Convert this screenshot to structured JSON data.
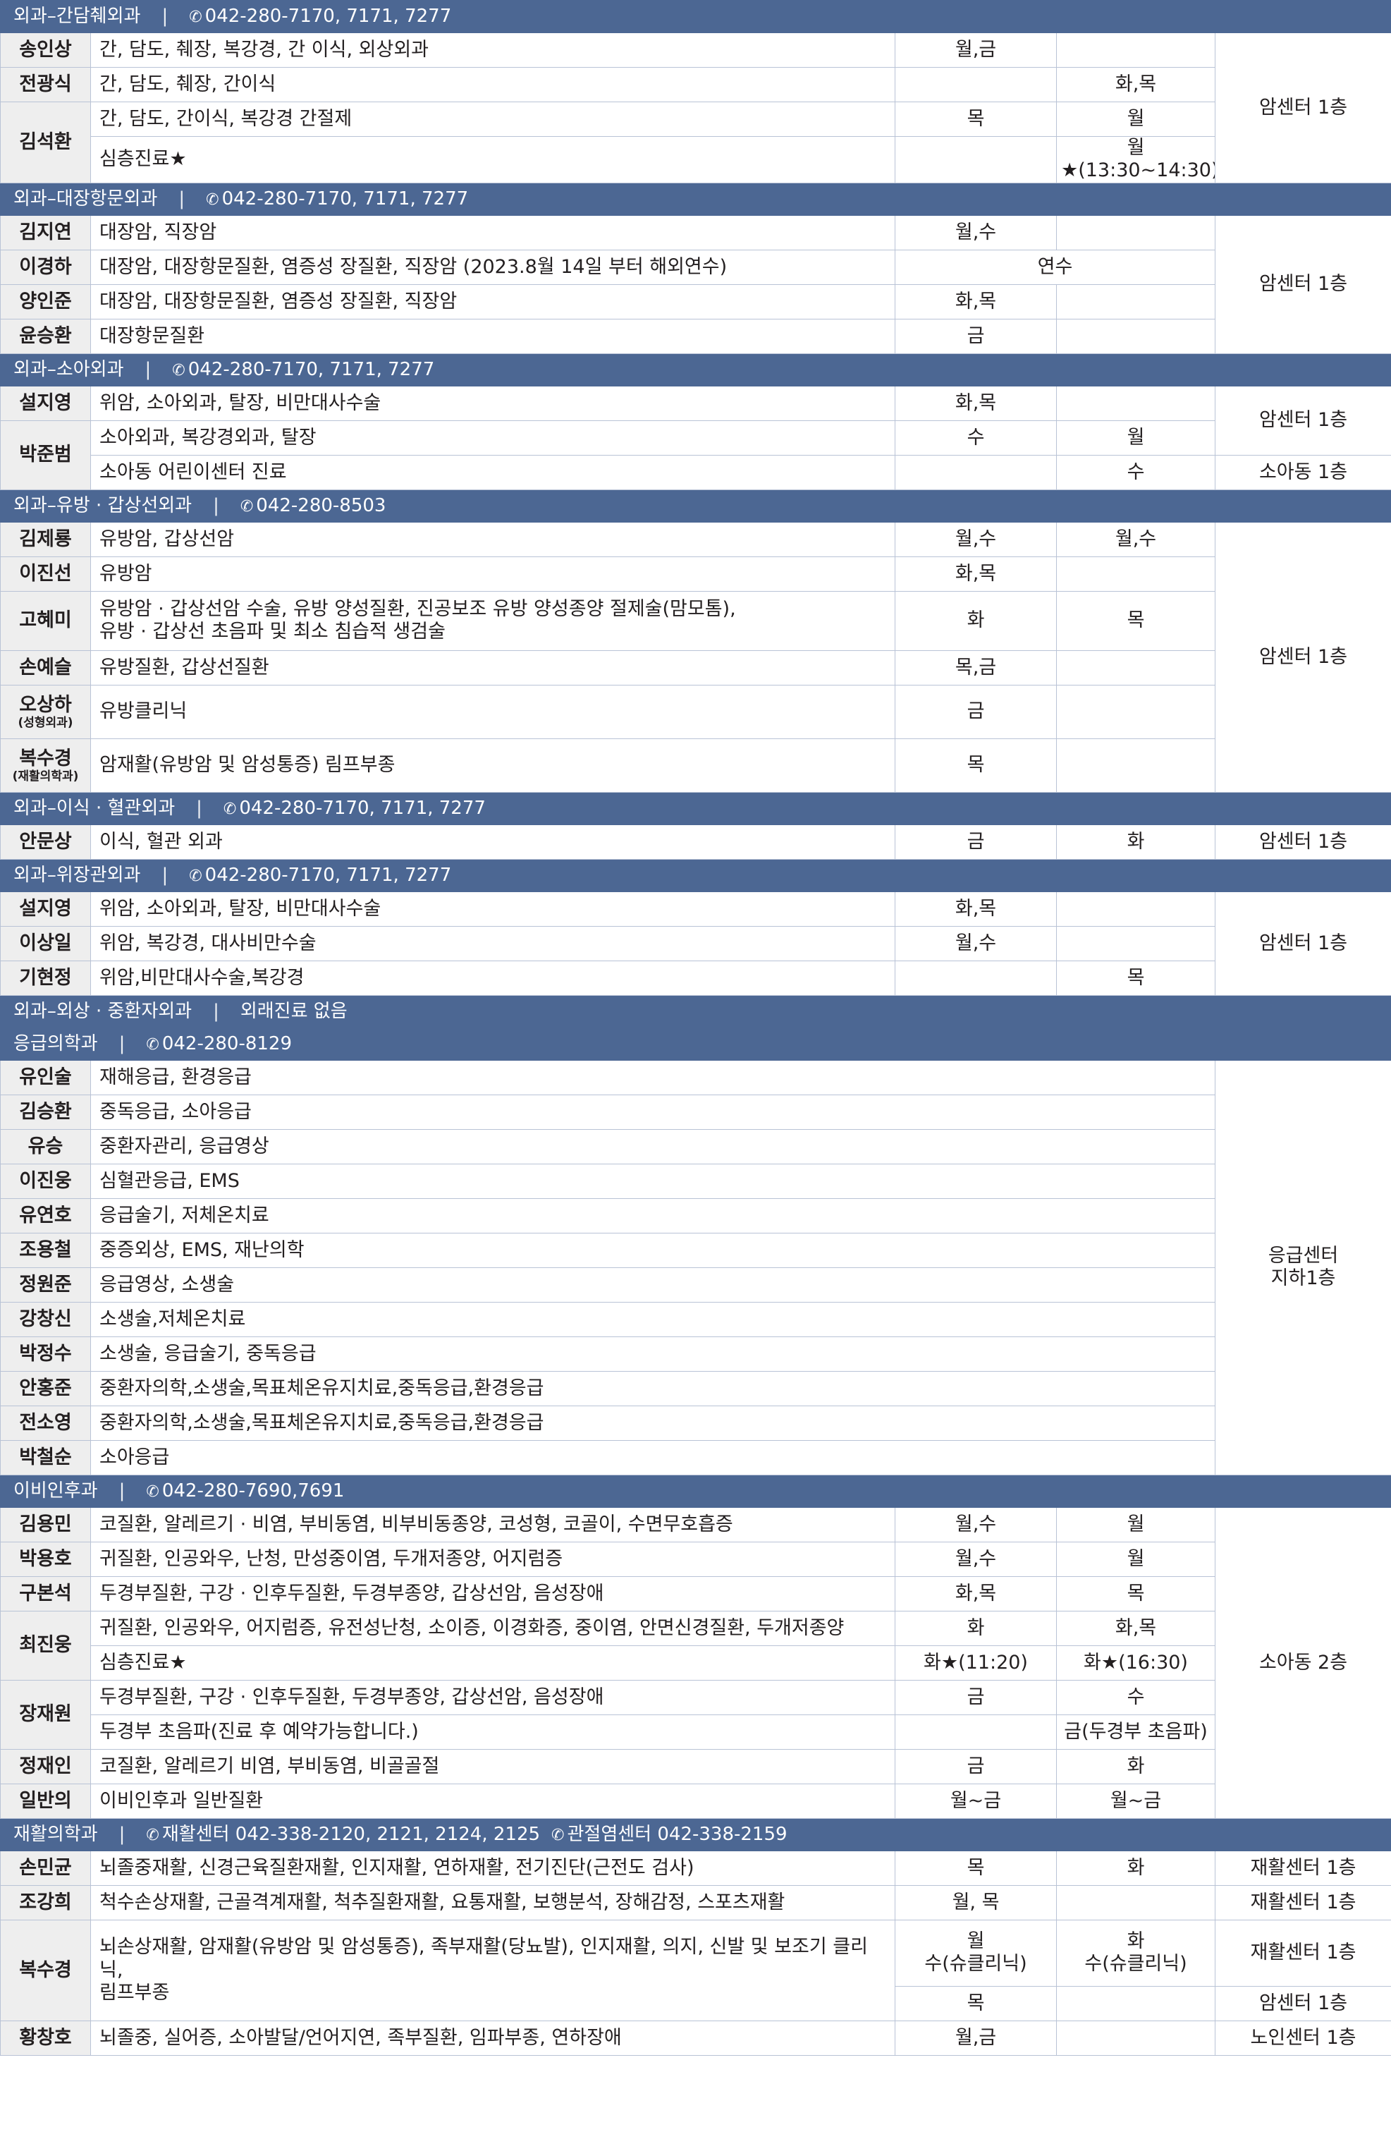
{
  "sections": {
    "s1": {
      "title": "외과–간담췌외과",
      "phone": "042-280-7170, 7171, 7277"
    },
    "s2": {
      "title": "외과–대장항문외과",
      "phone": "042-280-7170, 7171, 7277"
    },
    "s3": {
      "title": "외과–소아외과",
      "phone": "042-280-7170, 7171, 7277"
    },
    "s4": {
      "title": "외과–유방 · 갑상선외과",
      "phone": "042-280-8503"
    },
    "s5": {
      "title": "외과–이식 · 혈관외과",
      "phone": "042-280-7170, 7171, 7277"
    },
    "s6": {
      "title": "외과–위장관외과",
      "phone": "042-280-7170, 7171, 7277"
    },
    "s7": {
      "title": "외과–외상 · 중환자외과",
      "note": "외래진료 없음"
    },
    "s8": {
      "title": "응급의학과",
      "phone": "042-280-8129"
    },
    "s9": {
      "title": "이비인후과",
      "phone": "042-280-7690,7691"
    },
    "s10": {
      "title": "재활의학과",
      "phone1": "재활센터 042-338-2120, 2121, 2124, 2125",
      "phone2": "관절염센터 042-338-2159"
    }
  },
  "rows": {
    "s1": [
      {
        "name": "송인상",
        "area": "간, 담도, 췌장, 복강경, 간 이식, 외상외과",
        "am": "월,금",
        "pm": "",
        "loc": "암센터 1층"
      },
      {
        "name": "전광식",
        "area": "간, 담도, 췌장, 간이식",
        "am": "",
        "pm": "화,목"
      },
      {
        "name": "김석환",
        "area": "간, 담도, 간이식, 복강경 간절제",
        "am": "목",
        "pm": "월"
      },
      {
        "area": "심층진료★",
        "am": "",
        "pm": "월★(13:30~14:30)"
      }
    ],
    "s2": [
      {
        "name": "김지연",
        "area": "대장암, 직장암",
        "am": "월,수",
        "pm": "",
        "loc": "암센터 1층"
      },
      {
        "name": "이경하",
        "area": "대장암, 대장항문질환, 염증성 장질환, 직장암 (2023.8월 14일 부터 해외연수)",
        "span": "연수"
      },
      {
        "name": "양인준",
        "area": "대장암, 대장항문질환, 염증성 장질환, 직장암",
        "am": "화,목",
        "pm": ""
      },
      {
        "name": "윤승환",
        "area": "대장항문질환",
        "am": "금",
        "pm": ""
      }
    ],
    "s3": [
      {
        "name": "설지영",
        "area": "위암, 소아외과, 탈장, 비만대사수술",
        "am": "화,목",
        "pm": "",
        "loc": "암센터 1층"
      },
      {
        "name": "박준범",
        "area": "소아외과, 복강경외과, 탈장",
        "am": "수",
        "pm": "월"
      },
      {
        "area": "소아동 어린이센터 진료",
        "am": "",
        "pm": "수",
        "loc": "소아동 1층"
      }
    ],
    "s4": [
      {
        "name": "김제룡",
        "area": "유방암, 갑상선암",
        "am": "월,수",
        "pm": "월,수",
        "loc": "암센터 1층"
      },
      {
        "name": "이진선",
        "area": "유방암",
        "am": "화,목",
        "pm": ""
      },
      {
        "name": "고혜미",
        "area": "유방암 · 갑상선암 수술, 유방 양성질환, 진공보조 유방 양성종양 절제술(맘모톰),",
        "area2": "유방 · 갑상선 초음파 및 최소 침습적 생검술",
        "am": "화",
        "pm": "목"
      },
      {
        "name": "손예슬",
        "area": "유방질환, 갑상선질환",
        "am": "목,금",
        "pm": ""
      },
      {
        "name": "오상하",
        "sub": "(성형외과)",
        "area": "유방클리닉",
        "am": "금",
        "pm": ""
      },
      {
        "name": "복수경",
        "sub": "(재활의학과)",
        "area": "암재활(유방암 및 암성통증) 림프부종",
        "am": "목",
        "pm": ""
      }
    ],
    "s5": [
      {
        "name": "안문상",
        "area": "이식, 혈관 외과",
        "am": "금",
        "pm": "화",
        "loc": "암센터 1층"
      }
    ],
    "s6": [
      {
        "name": "설지영",
        "area": "위암, 소아외과, 탈장, 비만대사수술",
        "am": "화,목",
        "pm": "",
        "loc": "암센터 1층"
      },
      {
        "name": "이상일",
        "area": "위암, 복강경, 대사비만수술",
        "am": "월,수",
        "pm": ""
      },
      {
        "name": "기현정",
        "area": "위암,비만대사수술,복강경",
        "am": "",
        "pm": "목"
      }
    ],
    "s8": [
      {
        "name": "유인술",
        "area": "재해응급, 환경응급",
        "loc1": "응급센터",
        "loc2": "지하1층"
      },
      {
        "name": "김승환",
        "area": "중독응급, 소아응급"
      },
      {
        "name": "유승",
        "area": "중환자관리, 응급영상"
      },
      {
        "name": "이진웅",
        "area": "심혈관응급, EMS"
      },
      {
        "name": "유연호",
        "area": "응급술기, 저체온치료"
      },
      {
        "name": "조용철",
        "area": "중증외상, EMS, 재난의학"
      },
      {
        "name": "정원준",
        "area": "응급영상, 소생술"
      },
      {
        "name": "강창신",
        "area": "소생술,저체온치료"
      },
      {
        "name": "박정수",
        "area": "소생술, 응급술기, 중독응급"
      },
      {
        "name": "안홍준",
        "area": "중환자의학,소생술,목표체온유지치료,중독응급,환경응급"
      },
      {
        "name": "전소영",
        "area": "중환자의학,소생술,목표체온유지치료,중독응급,환경응급"
      },
      {
        "name": "박철순",
        "area": "소아응급"
      }
    ],
    "s9": [
      {
        "name": "김용민",
        "area": "코질환, 알레르기 · 비염, 부비동염, 비부비동종양, 코성형, 코골이, 수면무호흡증",
        "am": "월,수",
        "pm": "월",
        "loc": "소아동 2층"
      },
      {
        "name": "박용호",
        "area": "귀질환, 인공와우, 난청, 만성중이염, 두개저종양, 어지럼증",
        "am": "월,수",
        "pm": "월"
      },
      {
        "name": "구본석",
        "area": "두경부질환, 구강 · 인후두질환, 두경부종양, 갑상선암, 음성장애",
        "am": "화,목",
        "pm": "목"
      },
      {
        "name": "최진웅",
        "area": "귀질환, 인공와우, 어지럼증, 유전성난청, 소이증, 이경화증, 중이염, 안면신경질환, 두개저종양",
        "am": "화",
        "pm": "화,목"
      },
      {
        "area": "심층진료★",
        "am": "화★(11:20)",
        "pm": "화★(16:30)"
      },
      {
        "name": "장재원",
        "area": "두경부질환, 구강 · 인후두질환, 두경부종양, 갑상선암, 음성장애",
        "am": "금",
        "pm": "수"
      },
      {
        "area": "두경부 초음파(진료 후 예약가능합니다.)",
        "am": "",
        "pm": "금(두경부 초음파)"
      },
      {
        "name": "정재인",
        "area": "코질환, 알레르기 비염, 부비동염, 비골골절",
        "am": "금",
        "pm": "화"
      },
      {
        "name": "일반의",
        "area": "이비인후과 일반질환",
        "am": "월~금",
        "pm": "월~금"
      }
    ],
    "s10": [
      {
        "name": "손민균",
        "area": "뇌졸중재활, 신경근육질환재활, 인지재활, 연하재활, 전기진단(근전도 검사)",
        "am": "목",
        "pm": "화",
        "loc": "재활센터 1층"
      },
      {
        "name": "조강희",
        "area": "척수손상재활, 근골격계재활, 척추질환재활, 요통재활, 보행분석, 장해감정, 스포츠재활",
        "am": "월, 목",
        "pm": "",
        "loc": "재활센터 1층"
      },
      {
        "name": "복수경",
        "area": "뇌손상재활, 암재활(유방암 및 암성통증), 족부재활(당뇨발), 인지재활, 의지, 신발 및 보조기 클리닉,",
        "area2": "림프부종",
        "am": "월",
        "am2": "수(슈클리닉)",
        "pm": "화",
        "pm2": "수(슈클리닉)",
        "loc": "재활센터 1층"
      },
      {
        "am": "목",
        "pm": "",
        "loc": "암센터 1층"
      },
      {
        "name": "황창호",
        "area": "뇌졸중, 실어증, 소아발달/언어지연, 족부질환, 임파부종, 연하장애",
        "am": "월,금",
        "pm": "",
        "loc": "노인센터 1층"
      }
    ]
  }
}
